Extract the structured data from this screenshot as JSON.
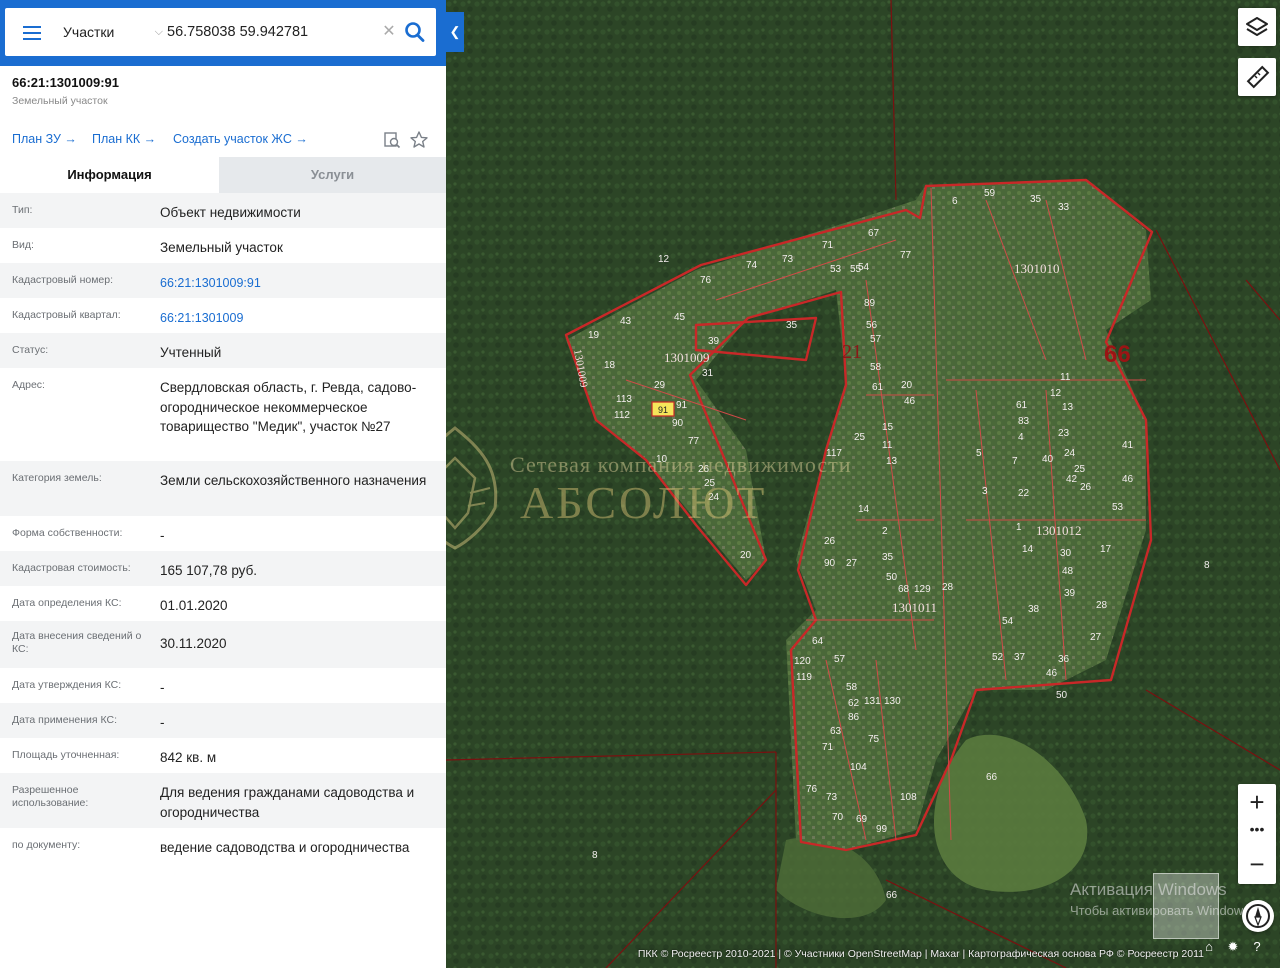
{
  "search": {
    "type_label": "Участки",
    "query": "56.758038 59.942781"
  },
  "object": {
    "id": "66:21:1301009:91",
    "type": "Земельный участок"
  },
  "links": [
    {
      "label": "План ЗУ →"
    },
    {
      "label": "План КК →"
    },
    {
      "label": "Создать участок ЖС →"
    }
  ],
  "tabs": {
    "info": "Информация",
    "services": "Услуги"
  },
  "props": [
    {
      "label": "Тип:",
      "value": "Объект недвижимости"
    },
    {
      "label": "Вид:",
      "value": "Земельный участок"
    },
    {
      "label": "Кадастровый номер:",
      "value": "66:21:1301009:91"
    },
    {
      "label": "Кадастровый квартал:",
      "value": "66:21:1301009"
    },
    {
      "label": "Статус:",
      "value": "Учтенный"
    },
    {
      "label": "Адрес:",
      "value": "Свердловская область, г. Ревда, садово-огородническое некоммерческое товарищество \"Медик\", участок №27"
    },
    {
      "label": "Категория земель:",
      "value": "Земли сельскохозяйственного назначения"
    },
    {
      "label": "Форма собственности:",
      "value": "-"
    },
    {
      "label": "Кадастровая стоимость:",
      "value": "165 107,78 руб."
    },
    {
      "label": "Дата определения КС:",
      "value": "01.01.2020"
    },
    {
      "label": "Дата внесения сведений о КС:",
      "value": "30.11.2020"
    },
    {
      "label": "Дата утверждения КС:",
      "value": "-"
    },
    {
      "label": "Дата применения КС:",
      "value": "-"
    },
    {
      "label": "Площадь уточненная:",
      "value": "842 кв. м"
    },
    {
      "label": "Разрешенное использование:",
      "value": "Для ведения гражданами садоводства и огородничества"
    },
    {
      "label": "по документу:",
      "value": "ведение садоводства и огородничества"
    }
  ],
  "map": {
    "quarter_labels": [
      "1301009",
      "1301010",
      "1301011",
      "1301012",
      "1301009"
    ],
    "district_labels": [
      "21",
      "66"
    ],
    "selected_parcel": "91",
    "parcel_numbers": [
      "12",
      "59",
      "35",
      "33",
      "6",
      "76",
      "74",
      "73",
      "71",
      "53",
      "55",
      "54",
      "77",
      "67",
      "19",
      "43",
      "45",
      "35",
      "18",
      "39",
      "31",
      "29",
      "91",
      "90",
      "113",
      "112",
      "10",
      "77",
      "26",
      "25",
      "24",
      "20",
      "89",
      "56",
      "57",
      "58",
      "61",
      "20",
      "46",
      "117",
      "25",
      "15",
      "11",
      "13",
      "14",
      "2",
      "35",
      "26",
      "27",
      "90",
      "50",
      "68",
      "129",
      "28",
      "64",
      "57",
      "120",
      "119",
      "58",
      "62",
      "86",
      "131",
      "130",
      "63",
      "75",
      "104",
      "71",
      "76",
      "73",
      "70",
      "69",
      "99",
      "108",
      "66",
      "66",
      "8",
      "8",
      "41",
      "46",
      "53",
      "28",
      "27",
      "36",
      "46",
      "50",
      "1",
      "14",
      "30",
      "48",
      "17",
      "39",
      "38",
      "54",
      "52",
      "37",
      "61",
      "83",
      "4",
      "7",
      "22",
      "40",
      "42",
      "5",
      "3",
      "11",
      "12",
      "13",
      "23",
      "24",
      "25",
      "26"
    ],
    "watermark_line1": "Сетевая компания недвижимости",
    "watermark_line2": "АБСОЛЮТ",
    "activation_line1": "Активация Windows",
    "activation_line2": "Чтобы активировать Windows",
    "attribution": "ПКК © Росреестр 2010-2021 | © Участники OpenStreetMap | Maxar | Картографическая основа РФ © Росреестр 2011"
  },
  "colors": {
    "accent": "#1a6dd1",
    "parcel_border": "#c82828",
    "selected_parcel": "#f5e65a"
  }
}
